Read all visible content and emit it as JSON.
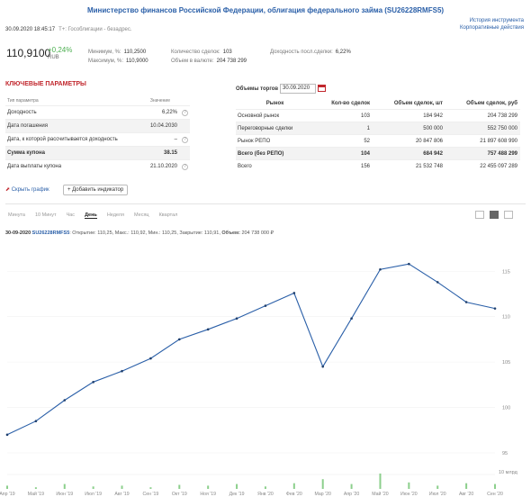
{
  "header": {
    "title": "Министерство финансов Российской Федерации, облигация федерального займа (SU26228RMFS5)",
    "link_history": "История инструмента",
    "link_corp": "Корпоративные действия",
    "datetime": "30.09.2020 18:45:17",
    "subtitle": "T+: Гособлигации - безадрес."
  },
  "quote": {
    "price": "110,9100",
    "change": "+0,24%",
    "currency": "RUB",
    "min_label": "Минимум, %:",
    "min_value": "110,2500",
    "max_label": "Максимум, %:",
    "max_value": "110,9000",
    "deals_label": "Количество сделок:",
    "deals_value": "103",
    "volume_label": "Объем в валюте:",
    "volume_value": "204 738 299",
    "yield_label": "Доходность посл.сделки:",
    "yield_value": "6,22%"
  },
  "key_params": {
    "title": "КЛЮЧЕВЫЕ ПАРАМЕТРЫ",
    "col_type": "Тип параметра",
    "col_value": "Значение",
    "rows": [
      {
        "label": "Доходность",
        "value": "6,22%"
      },
      {
        "label": "Дата погашения",
        "value": "10.04.2030"
      },
      {
        "label": "Дата, к которой рассчитывается доходность",
        "value": "–"
      },
      {
        "label": "Сумма купона",
        "value": "38.15"
      },
      {
        "label": "Дата выплаты купона",
        "value": "21.10.2020"
      }
    ]
  },
  "actions": {
    "hide_graph": "Скрыть график",
    "add_indicator": "+ Добавить индикатор"
  },
  "volumes": {
    "title": "Объемы торгов",
    "date": "30.09.2020",
    "headers": [
      "Рынок",
      "Кол-во сделок",
      "Объем сделок, шт",
      "Объем сделок, руб"
    ],
    "rows": [
      [
        "Основной рынок",
        "103",
        "184 942",
        "204 738 299"
      ],
      [
        "Переговорные сделки",
        "1",
        "500 000",
        "552 750 000"
      ],
      [
        "Рынок РЕПО",
        "52",
        "20 847 806",
        "21 897 608 990"
      ],
      [
        "Всего (без РЕПО)",
        "104",
        "684 942",
        "757 488 299"
      ],
      [
        "Всего",
        "156",
        "21 532 748",
        "22 455 097 289"
      ]
    ]
  },
  "timeframes": [
    "Минута",
    "10 Минут",
    "Час",
    "День",
    "Неделя",
    "Месяц",
    "Квартал"
  ],
  "timeframe_active": "День",
  "ohlc": {
    "date": "30-09-2020",
    "ticker": "SU26228RMFS5",
    "text": ": Открытие: 110,25, Макс.: 110,92, Мин.: 110,25, Закрытие: 110,91,",
    "volume_label": "Объем:",
    "volume_value": "204 738 000 ₽"
  },
  "chart_data": {
    "type": "line",
    "x": [
      "Апр '19",
      "Май '19",
      "Июн '19",
      "Июл '19",
      "Авг '19",
      "Сен '19",
      "Окт '19",
      "Ноя '19",
      "Дек '19",
      "Янв '20",
      "Фев '20",
      "Мар '20",
      "Апр '20",
      "Май '20",
      "Июн '20",
      "Июл '20",
      "Авг '20",
      "Сен '20"
    ],
    "y": [
      97.0,
      98.5,
      100.8,
      102.8,
      104.0,
      105.4,
      107.5,
      108.6,
      109.8,
      111.2,
      112.6,
      104.5,
      109.8,
      115.2,
      115.8,
      113.8,
      111.6,
      110.9
    ],
    "ylim": [
      95,
      118
    ],
    "yticks": [
      "95",
      "100",
      "105",
      "110",
      "115"
    ],
    "volume_label": "10 млрд",
    "xlabel": "",
    "ylabel": "",
    "grid": true
  },
  "colors": {
    "link": "#2a5fa8",
    "accent": "#c1272d",
    "positive": "#4caf50",
    "price_line": "#2a5fa8"
  }
}
